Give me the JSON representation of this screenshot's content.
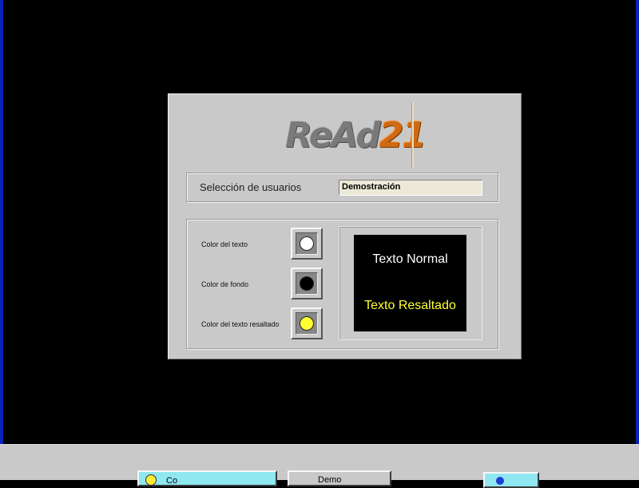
{
  "dialog": {
    "logo": {
      "part_a": "ReAd",
      "part_b": "21"
    },
    "users": {
      "label": "Selección de usuarios",
      "value": "Demostración"
    },
    "colors": {
      "text_color_label": "Color del texto",
      "background_color_label": "Color de fondo",
      "highlight_color_label": "Color del texto resaltado",
      "text_color": "#ffffff",
      "background_color": "#000000",
      "highlight_color": "#ffff33"
    },
    "preview": {
      "normal": "Texto Normal",
      "highlight": "Texto Resaltado"
    }
  },
  "bottom": {
    "primary_button": {
      "label": "Co",
      "icon": "lightbulb-icon"
    },
    "secondary_button": {
      "label": "Demo"
    },
    "tertiary_button": {
      "icon": "user-icon"
    }
  }
}
